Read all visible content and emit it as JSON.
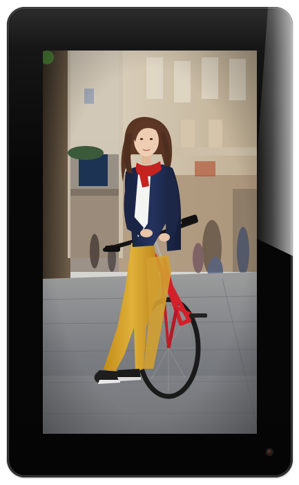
{
  "device": {
    "type": "tablet",
    "body_color": "#060606",
    "screen_content": "photo"
  },
  "photo": {
    "palette": {
      "sky": "#d9dde2",
      "buildings": "#b9a891",
      "street": "#7b7f86",
      "jacket": "#1e2a4d",
      "pants": "#d8a52a",
      "scarf": "#c4231f",
      "bike_frame": "#d3202a",
      "hair": "#5a3524",
      "skin": "#e8c4a8"
    }
  }
}
